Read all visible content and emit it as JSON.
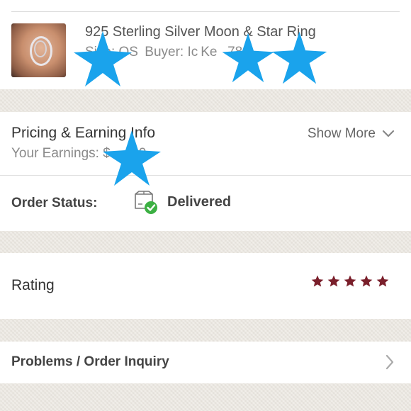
{
  "item": {
    "title": "925 Sterling Silver Moon & Star Ring",
    "size_label": "Size: OS",
    "buyer_label": "Buyer: Ic",
    "buyer_tail": "Ke",
    "buyer_digits": "78"
  },
  "pricing": {
    "title": "Pricing & Earning Info",
    "earnings_label": "Your Earnings:",
    "earnings_prefix": "$",
    "earnings_tail": "0",
    "show_more": "Show More"
  },
  "order": {
    "status_label": "Order Status:",
    "status_value": "Delivered"
  },
  "rating": {
    "label": "Rating",
    "stars": 5,
    "star_color": "#7a1f2b"
  },
  "problems": {
    "label": "Problems / Order Inquiry"
  },
  "colors": {
    "censor_star": "#1aa3ec",
    "delivered_check": "#3cb043"
  }
}
